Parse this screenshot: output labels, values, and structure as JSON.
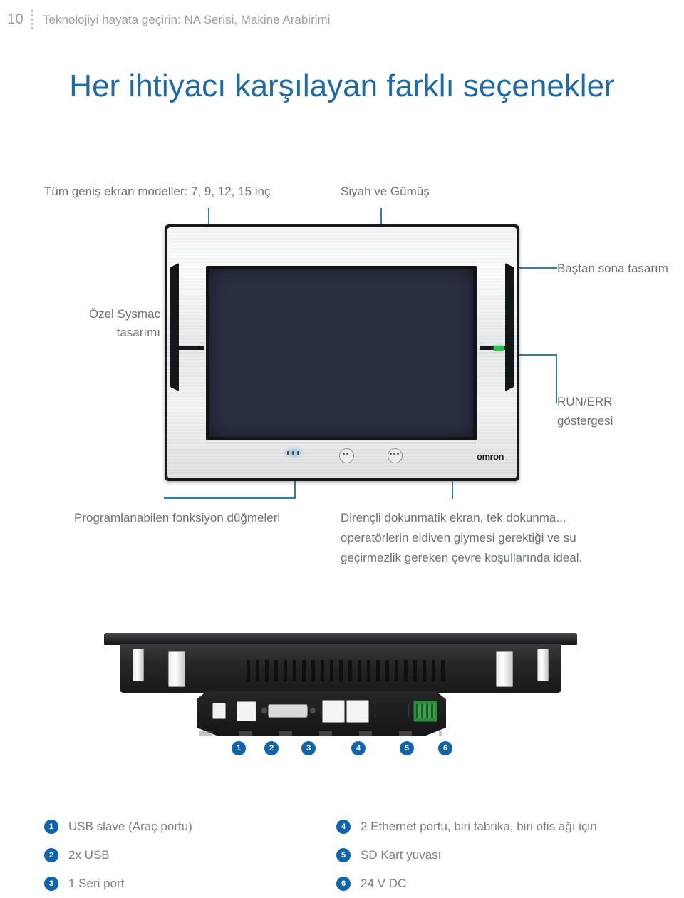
{
  "header": {
    "page_number": "10",
    "breadcrumb": "Teknolojiyi hayata geçirin: NA Serisi, Makine Arabirimi"
  },
  "title": "Her ihtiyacı karşılayan farklı seçenekler",
  "colors": {
    "accent_blue": "#1f6aa5",
    "leader_line": "#2b7fb4",
    "badge_blue": "#1164ab",
    "body_text": "#6e7276",
    "led_green": "#2fbf4f"
  },
  "front_view": {
    "brand": "omron",
    "callouts": {
      "models": "Tüm geniş ekran modeller: 7, 9, 12, 15 inç",
      "colors": "Siyah ve Gümüş",
      "sysmac": "Özel Sysmac tasarımı",
      "end_to_end": "Baştan sona tasarım",
      "run_err": "RUN/ERR göstergesi",
      "function_buttons": "Programlanabilen fonksiyon düğmeleri",
      "touchscreen": "Dirençli dokunmatik ekran, tek dokunma... operatörlerin eldiven giymesi gerektiği ve su geçirmezlik gereken çevre koşullarında ideal."
    }
  },
  "rear_view": {
    "port_markers": [
      "1",
      "2",
      "3",
      "4",
      "5",
      "6"
    ]
  },
  "legend": {
    "left": [
      {
        "num": "1",
        "label": "USB slave (Araç portu)"
      },
      {
        "num": "2",
        "label": "2x USB"
      },
      {
        "num": "3",
        "label": "1 Seri port"
      }
    ],
    "right": [
      {
        "num": "4",
        "label": "2 Ethernet portu, biri fabrika, biri ofis ağı için"
      },
      {
        "num": "5",
        "label": "SD Kart yuvası"
      },
      {
        "num": "6",
        "label": "24 V DC"
      }
    ]
  }
}
